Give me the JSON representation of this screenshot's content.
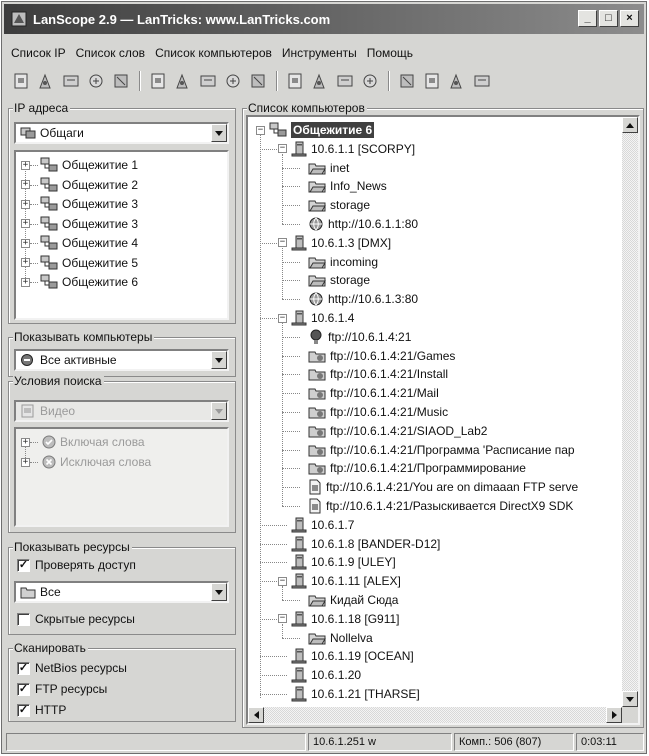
{
  "window": {
    "title": "LanScope 2.9 — LanTricks: www.LanTricks.com",
    "btn_min": "_",
    "btn_max": "□",
    "btn_close": "×"
  },
  "menu": [
    "Список IP",
    "Список слов",
    "Список компьютеров",
    "Инструменты",
    "Помощь"
  ],
  "toolbar_icons": [
    "ip-list-new-icon",
    "ip-list-open-icon",
    "ip-list-save-icon",
    "ip-list-edit-icon",
    "ip-list-delete-icon",
    "search-icon",
    "search-next-icon",
    "search-stop-icon",
    "search-back-icon",
    "document-icon",
    "computer-add-icon",
    "computer-edit-icon",
    "computer-delete-icon",
    "computer-find-icon",
    "cursor-tool-icon",
    "settings-icon",
    "help-icon",
    "info-icon"
  ],
  "ip_panel": {
    "label": "IP адреса",
    "combo_value": "Общаги",
    "items": [
      "Общежитие 1",
      "Общежитие 2",
      "Общежитие 3",
      "Общежитие 3",
      "Общежитие 4",
      "Общежитие 5",
      "Общежитие 6"
    ]
  },
  "show_computers": {
    "label": "Показывать компьютеры",
    "value": "Все активные"
  },
  "search_conditions": {
    "label": "Условия поиска",
    "combo_value": "Видео",
    "items": [
      "Включая слова",
      "Исключая слова"
    ]
  },
  "show_resources": {
    "label": "Показывать ресурсы",
    "check_access": "Проверять доступ",
    "check_access_checked": true,
    "combo_value": "Все",
    "hidden_resources": "Скрытые ресурсы",
    "hidden_resources_checked": false
  },
  "scan": {
    "label": "Сканировать",
    "items": [
      {
        "text": "NetBios ресурсы",
        "checked": true
      },
      {
        "text": "FTP ресурсы",
        "checked": true
      },
      {
        "text": "HTTP",
        "checked": true
      }
    ]
  },
  "computers": {
    "label": "Список компьютеров",
    "root": "Общежитие 6",
    "tree": [
      {
        "level": 1,
        "type": "computer",
        "text": "10.6.1.1 [SCORPY]",
        "pm": "−"
      },
      {
        "level": 2,
        "type": "share",
        "text": "inet"
      },
      {
        "level": 2,
        "type": "share",
        "text": "Info_News"
      },
      {
        "level": 2,
        "type": "share",
        "text": "storage"
      },
      {
        "level": 2,
        "type": "http",
        "text": "http://10.6.1.1:80"
      },
      {
        "level": 1,
        "type": "computer",
        "text": "10.6.1.3 [DMX]",
        "pm": "−"
      },
      {
        "level": 2,
        "type": "share",
        "text": "incoming"
      },
      {
        "level": 2,
        "type": "share",
        "text": "storage"
      },
      {
        "level": 2,
        "type": "http",
        "text": "http://10.6.1.3:80"
      },
      {
        "level": 1,
        "type": "computer",
        "text": "10.6.1.4",
        "pm": "−"
      },
      {
        "level": 2,
        "type": "ftproot",
        "text": "ftp://10.6.1.4:21"
      },
      {
        "level": 2,
        "type": "ftp",
        "text": "ftp://10.6.1.4:21/Games"
      },
      {
        "level": 2,
        "type": "ftp",
        "text": "ftp://10.6.1.4:21/Install"
      },
      {
        "level": 2,
        "type": "ftp",
        "text": "ftp://10.6.1.4:21/Mail"
      },
      {
        "level": 2,
        "type": "ftp",
        "text": "ftp://10.6.1.4:21/Music"
      },
      {
        "level": 2,
        "type": "ftp",
        "text": "ftp://10.6.1.4:21/SIAOD_Lab2"
      },
      {
        "level": 2,
        "type": "ftp",
        "text": "ftp://10.6.1.4:21/Программа 'Расписание пар"
      },
      {
        "level": 2,
        "type": "ftp",
        "text": "ftp://10.6.1.4:21/Программирование"
      },
      {
        "level": 2,
        "type": "file",
        "text": "ftp://10.6.1.4:21/You are on dimaaan FTP serve"
      },
      {
        "level": 2,
        "type": "file",
        "text": "ftp://10.6.1.4:21/Разыскивается DirectX9 SDK"
      },
      {
        "level": 1,
        "type": "computer",
        "text": "10.6.1.7",
        "pm": ""
      },
      {
        "level": 1,
        "type": "computer",
        "text": "10.6.1.8 [BANDER-D12]",
        "pm": ""
      },
      {
        "level": 1,
        "type": "computer",
        "text": "10.6.1.9 [ULEY]",
        "pm": ""
      },
      {
        "level": 1,
        "type": "computer",
        "text": "10.6.1.11 [ALEX]",
        "pm": "−"
      },
      {
        "level": 2,
        "type": "share",
        "text": "Кидай Сюда"
      },
      {
        "level": 1,
        "type": "computer",
        "text": "10.6.1.18 [G911]",
        "pm": "−"
      },
      {
        "level": 2,
        "type": "share",
        "text": "Nollelva"
      },
      {
        "level": 1,
        "type": "computer",
        "text": "10.6.1.19 [OCEAN]",
        "pm": ""
      },
      {
        "level": 1,
        "type": "computer",
        "text": "10.6.1.20",
        "pm": ""
      },
      {
        "level": 1,
        "type": "computer",
        "text": "10.6.1.21 [THARSE]",
        "pm": ""
      }
    ]
  },
  "status": {
    "ip": "10.6.1.251 w",
    "count": "Комп.: 506 (807)",
    "time": "0:03:11"
  }
}
